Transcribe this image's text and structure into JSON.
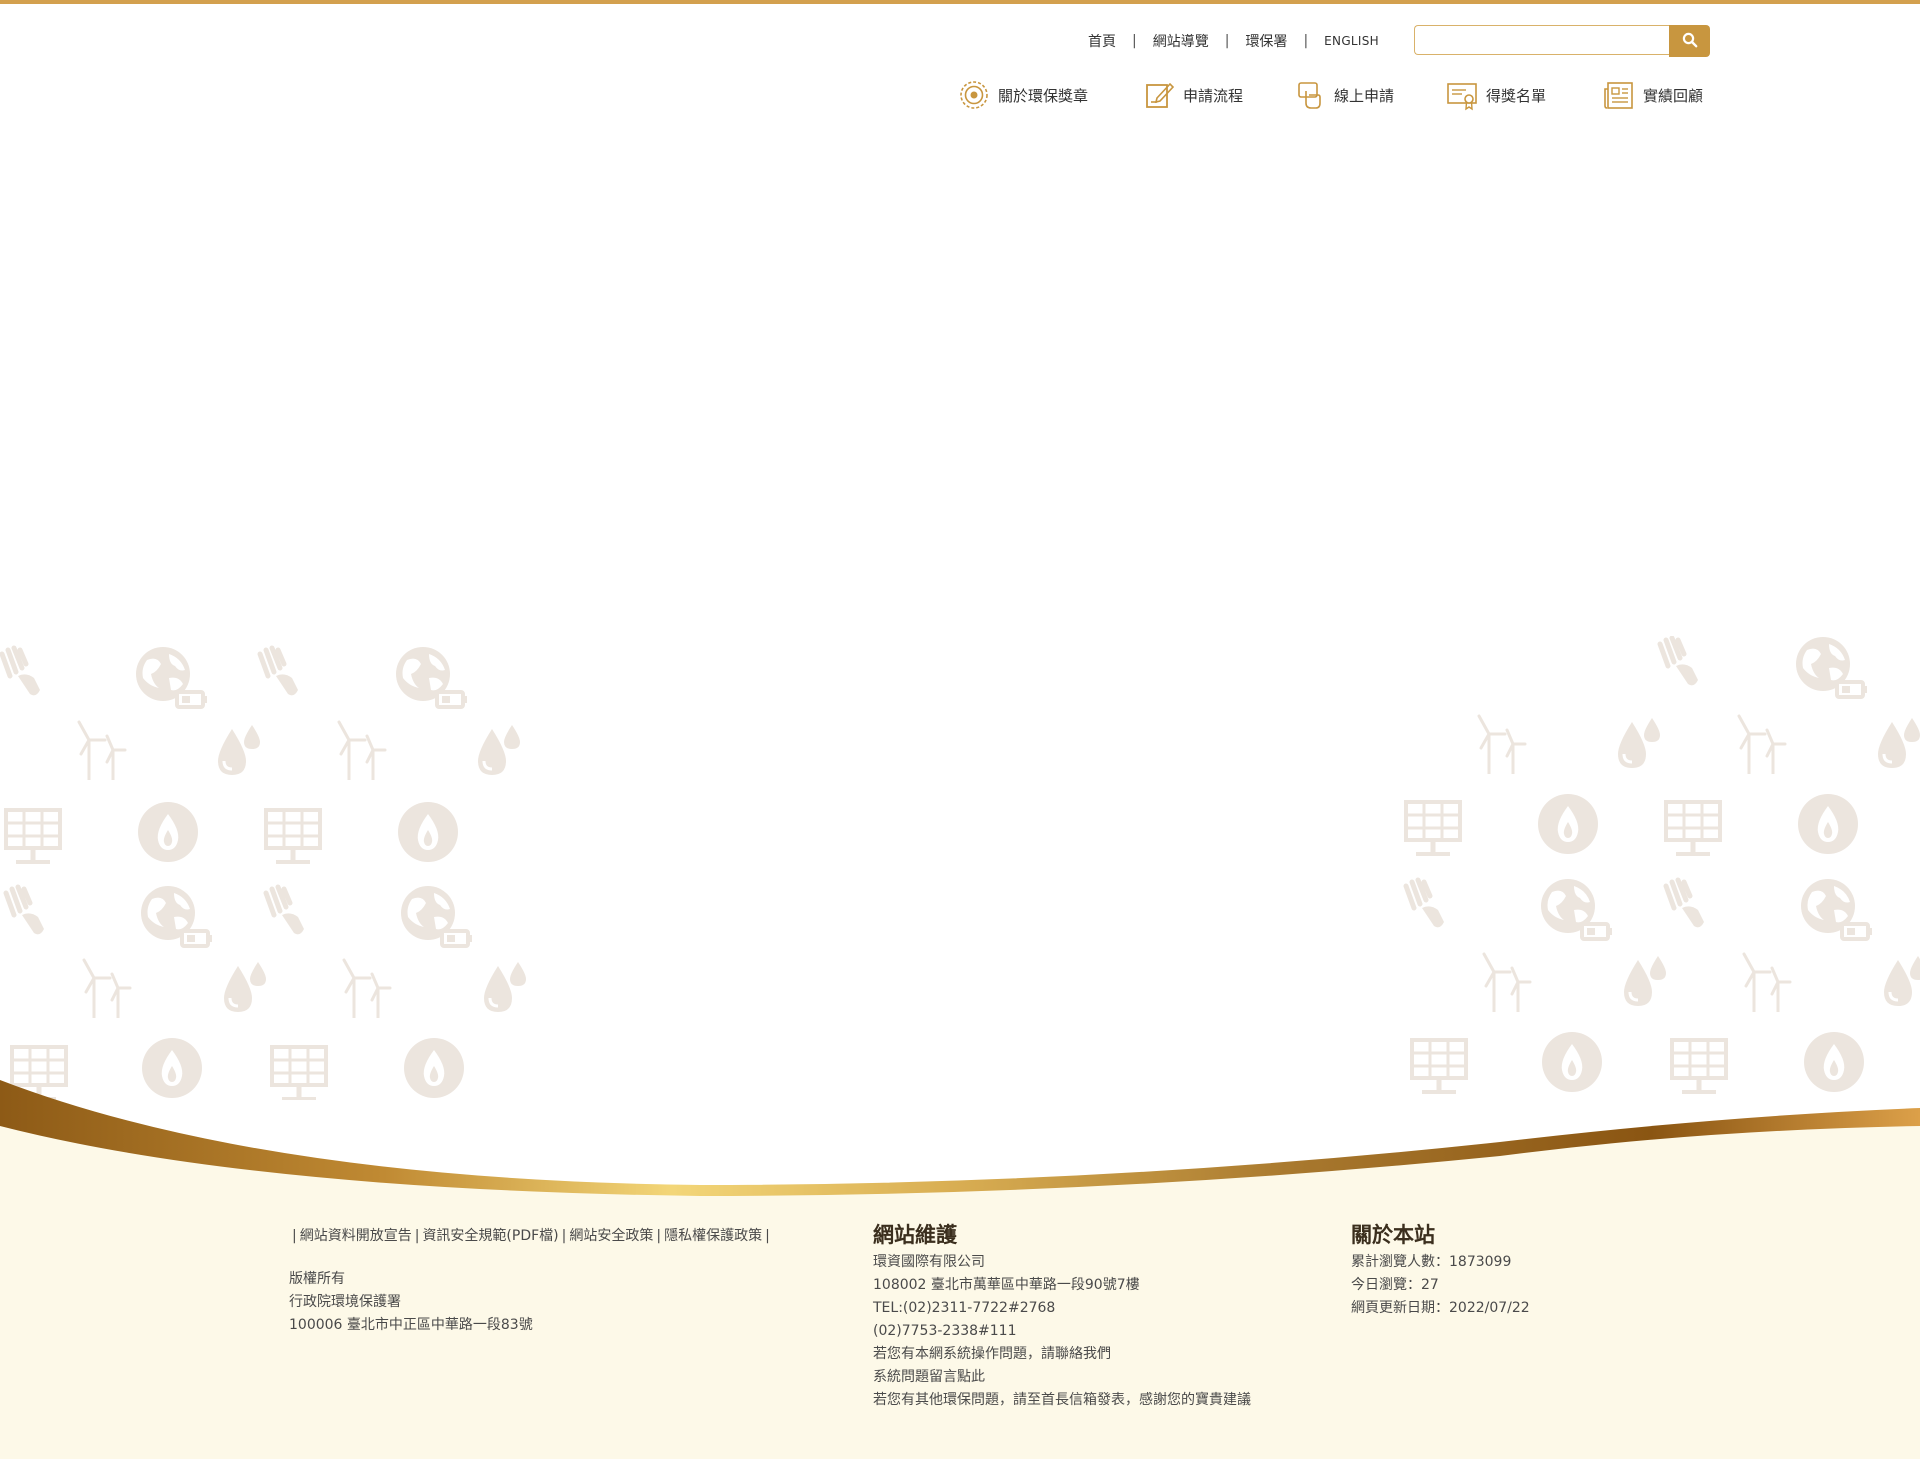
{
  "utility_links": {
    "home": "首頁",
    "sitemap": "網站導覽",
    "epa": "環保署",
    "english": "ENGLISH"
  },
  "search": {
    "placeholder": "",
    "button_icon": "search-icon"
  },
  "main_nav": [
    {
      "label": "關於環保獎章",
      "icon": "medal-icon"
    },
    {
      "label": "申請流程",
      "icon": "edit-document-icon"
    },
    {
      "label": "線上申請",
      "icon": "hand-touch-icon"
    },
    {
      "label": "得獎名單",
      "icon": "certificate-icon"
    },
    {
      "label": "實績回顧",
      "icon": "newspaper-icon"
    }
  ],
  "footer": {
    "policy_links": [
      "網站資料開放宣告",
      "資訊安全規範(PDF檔)",
      "網站安全政策",
      "隱私權保護政策"
    ],
    "copyright_label": "版權所有",
    "agency": "行政院環境保護署",
    "agency_address": "100006 臺北市中正區中華路一段83號",
    "maintenance": {
      "title": "網站維護",
      "company": "環資國際有限公司",
      "address": "108002 臺北市萬華區中華路一段90號7樓",
      "tel": "TEL:(02)2311-7722#2768",
      "tel2": "(02)7753-2338#111",
      "contact_note": "若您有本網系統操作問題，請聯絡我們",
      "message_link": "系統問題留言點此",
      "mailbox_note": "若您有其他環保問題，請至首長信箱發表，感謝您的寶貴建議"
    },
    "about": {
      "title": "關於本站",
      "total_visitors": "累計瀏覽人數：1873099",
      "today_visits": "今日瀏覽：27",
      "updated": "網頁更新日期：2022/07/22"
    }
  },
  "colors": {
    "accent": "#c8963f",
    "top_bar": "#d3a04e",
    "footer_bg": "#fdf9e8",
    "deco_icon": "#ece5de"
  }
}
